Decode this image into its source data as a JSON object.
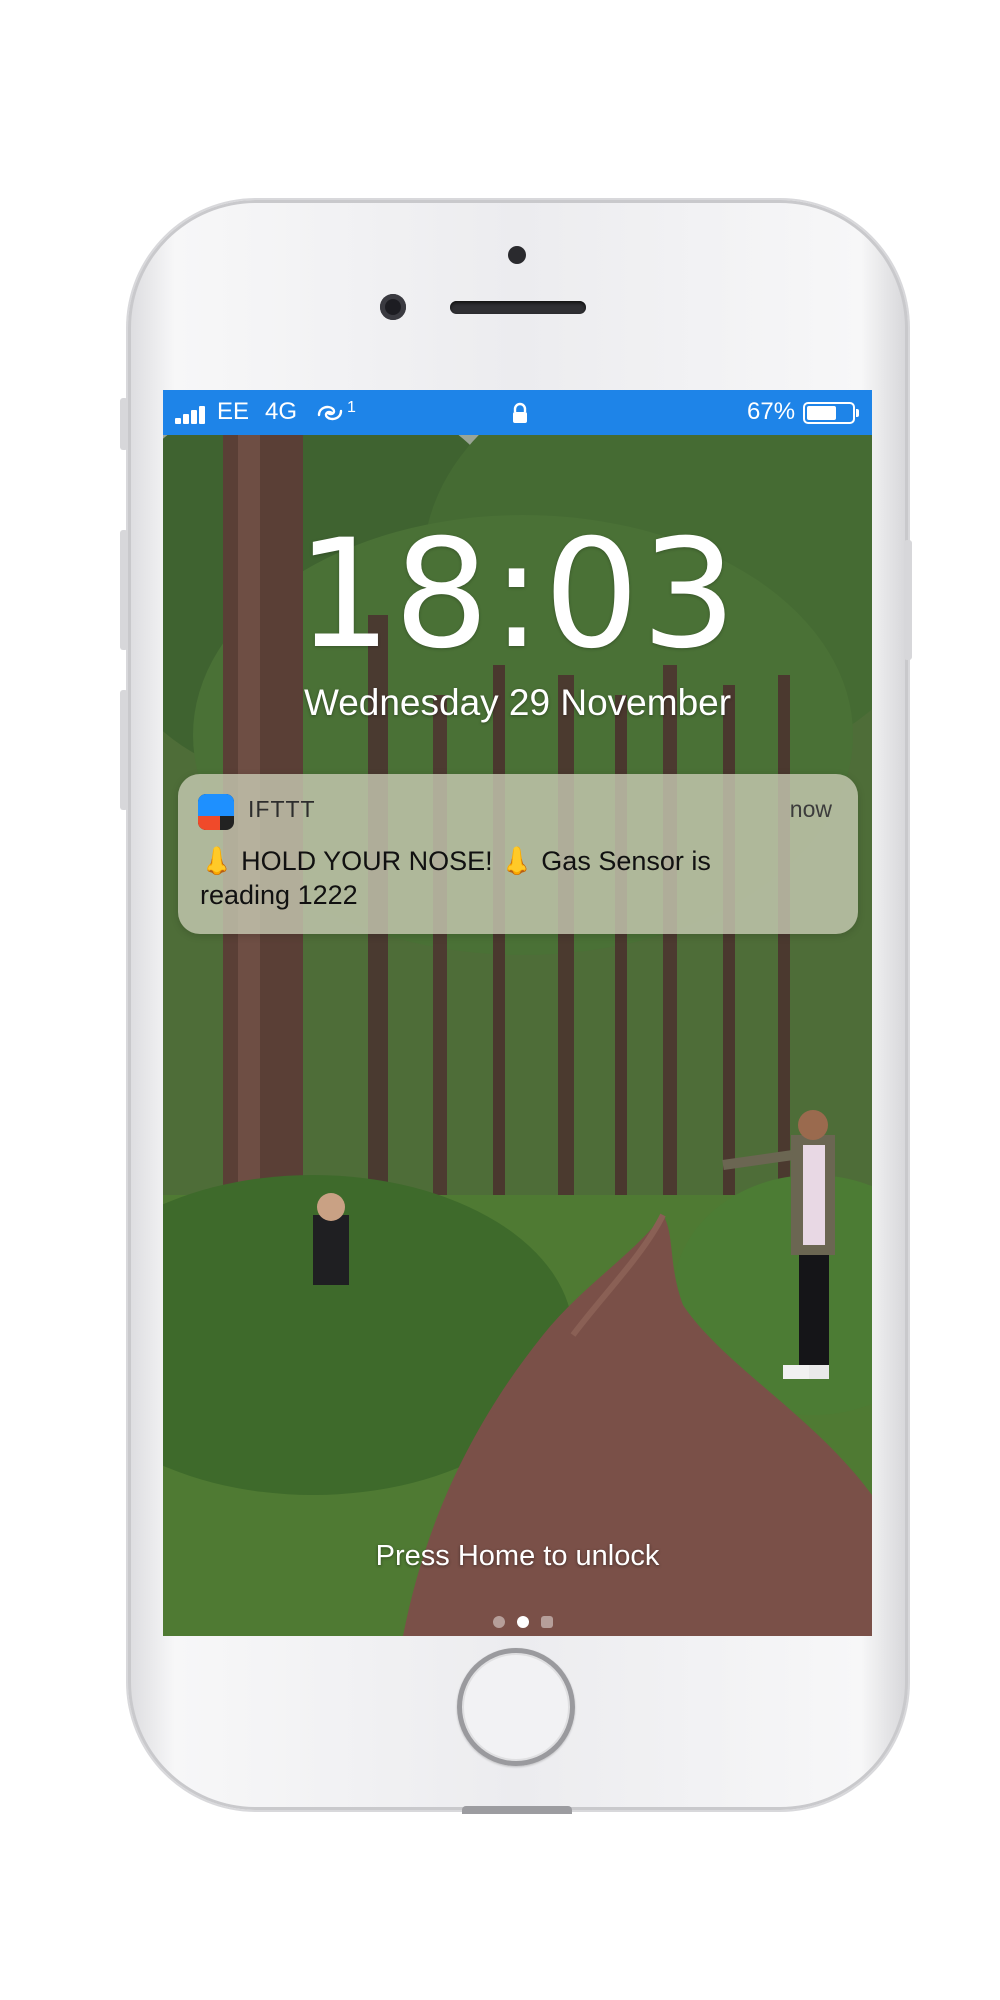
{
  "status_bar": {
    "carrier": "EE",
    "network": "4G",
    "link_indicator": "1",
    "battery_percent": "67%",
    "battery_level": 0.67,
    "icons": [
      "signal-bars-icon",
      "link-icon",
      "lock-icon",
      "battery-icon"
    ]
  },
  "lock_screen": {
    "time": "18:03",
    "date": "Wednesday 29 November",
    "unlock_hint": "Press Home to unlock",
    "page_dots": {
      "count": 3,
      "active_index": 1
    }
  },
  "notification": {
    "app_name": "IFTTT",
    "time": "now",
    "message": "👃 HOLD YOUR NOSE! 👃 Gas Sensor is reading 1222",
    "icon": "ifttt-app-icon"
  },
  "colors": {
    "status_bar": "#1e84e8",
    "notification_background": "#c8cab4",
    "ifttt_blue": "#1e90ff",
    "ifttt_red": "#f04a2a"
  }
}
